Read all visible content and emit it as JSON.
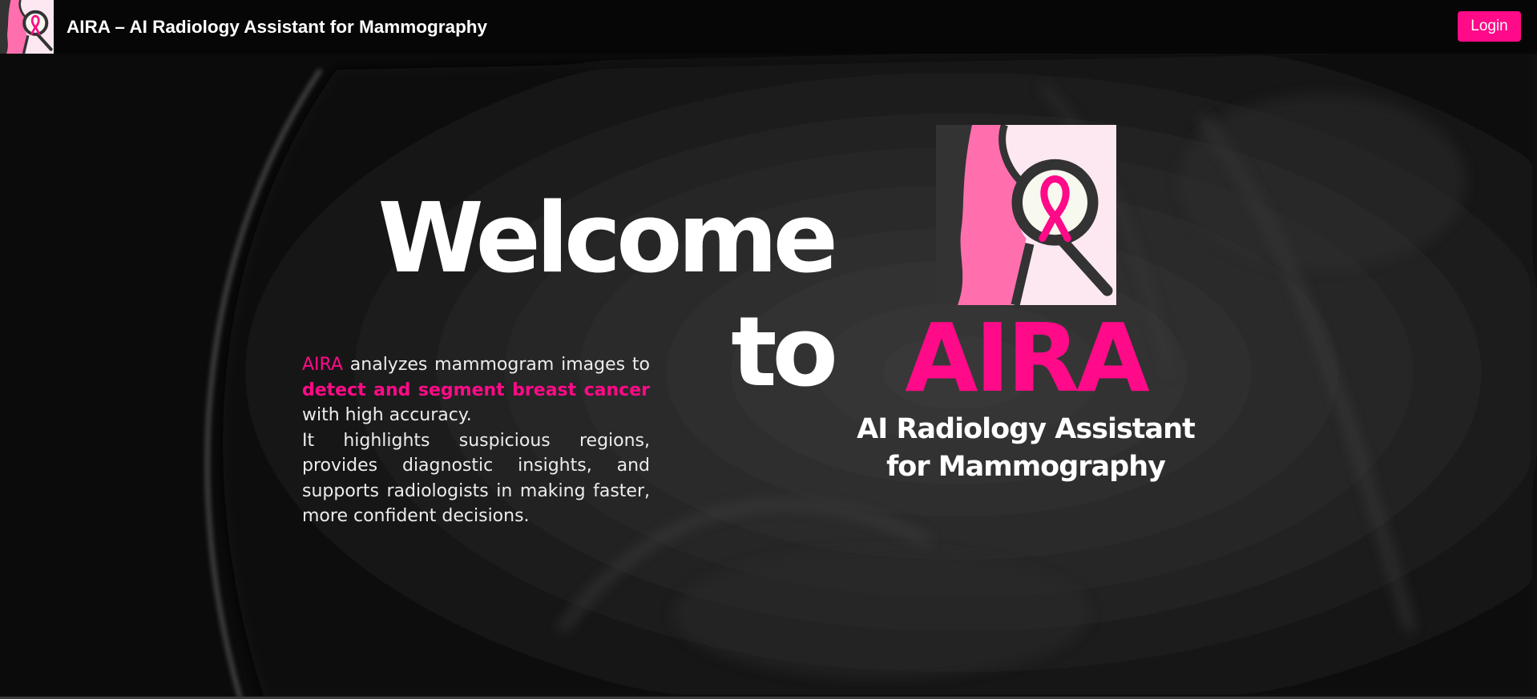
{
  "navbar": {
    "logo_icon": "breast-ribbon-magnifier-logo",
    "title": "AIRA – AI Radiology Assistant for Mammography",
    "login_label": "Login"
  },
  "hero": {
    "welcome_line1": "Welcome",
    "welcome_line2": "to",
    "brand": "AIRA",
    "subtitle_line1": "AI Radiology Assistant",
    "subtitle_line2": "for Mammography",
    "description": {
      "brand": "AIRA",
      "text1": " analyzes mammogram images to ",
      "highlight": "detect and segment breast cancer",
      "text2": " with high accuracy.",
      "text3": "It highlights suspicious regions, provides diagnostic insights, and supports radiologists in making faster, more confident decisions."
    }
  },
  "colors": {
    "accent": "#ff0a88",
    "logo_breast": "#ff6fae",
    "logo_bg": "#fde8f2",
    "logo_dark": "#333333",
    "background": "#0a0a0a"
  }
}
